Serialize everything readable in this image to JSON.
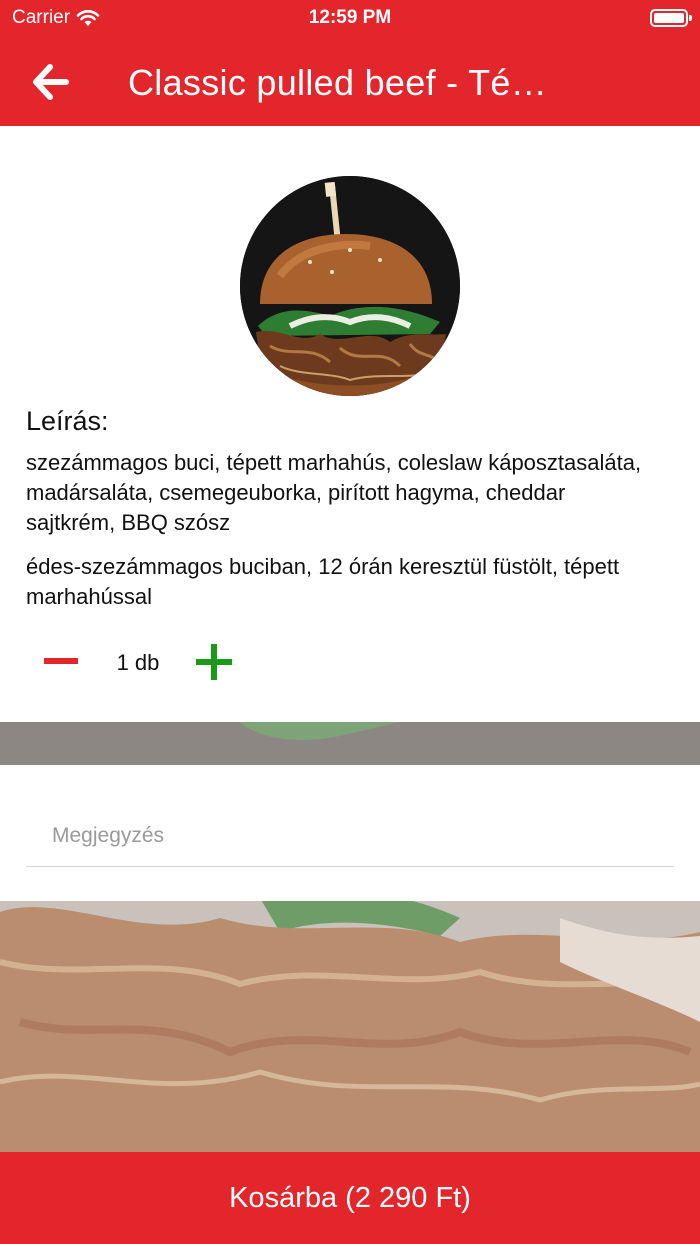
{
  "status_bar": {
    "carrier": "Carrier",
    "time": "12:59 PM"
  },
  "navbar": {
    "title": "Classic pulled beef - Té…",
    "back_icon": "arrow-left-icon"
  },
  "product": {
    "image_icon": "burger-photo",
    "description_heading": "Leírás:",
    "description": "szezámmagos buci, tépett marhahús, coleslaw káposztasaláta, madársaláta, csemegeuborka, pirított hagyma, cheddar sajtkrém, BBQ szósz",
    "description_extra": "édes-szezámmagos buciban, 12 órán keresztül füstölt, tépett marhahússal"
  },
  "quantity": {
    "value": "1 db",
    "minus_icon": "minus-icon",
    "plus_icon": "plus-icon"
  },
  "note": {
    "placeholder": "Megjegyzés",
    "value": ""
  },
  "cart_button": {
    "label": "Kosárba (2 290 Ft)"
  },
  "colors": {
    "brand": "#e3262b",
    "plus": "#1a9a1a",
    "minus": "#e3262b"
  }
}
